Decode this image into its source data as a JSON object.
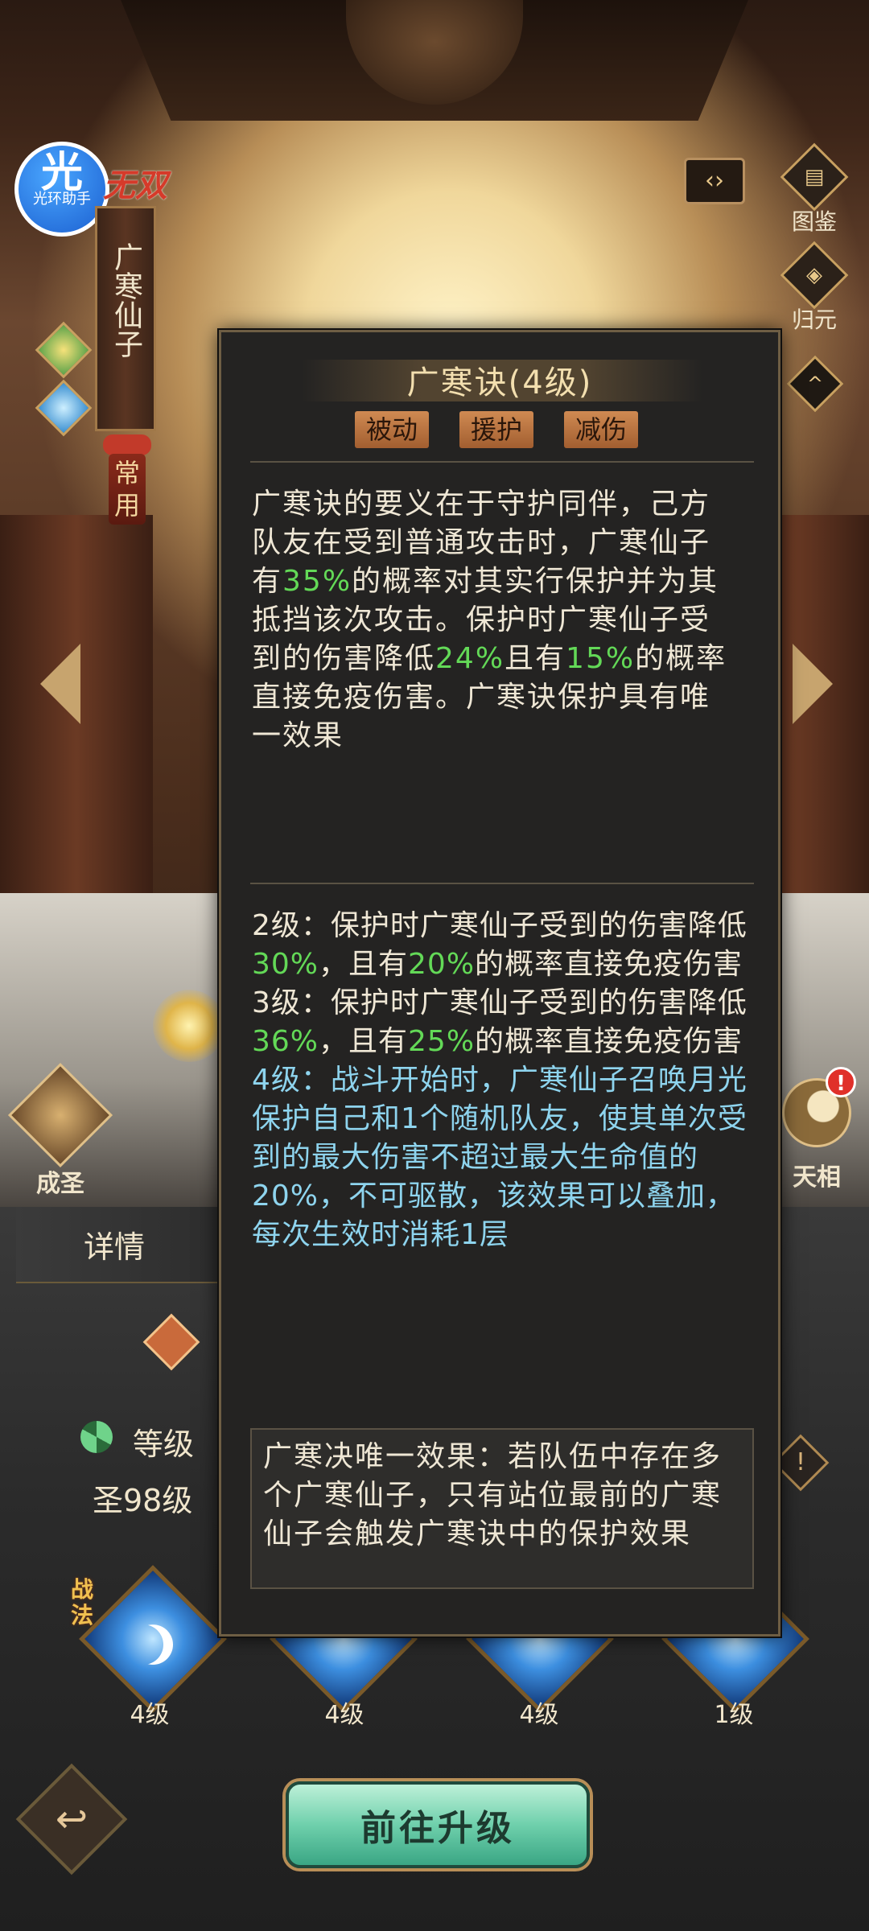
{
  "hero": {
    "badge_text": "光",
    "badge_sub": "光环助手",
    "title_tag": "无双",
    "name": "广寒仙子",
    "common_tag": "常用"
  },
  "side": {
    "tujian": "图鉴",
    "guiyuan": "归元",
    "chengsheng": "成圣",
    "tianxiang": "天相",
    "alert": "!"
  },
  "detail": {
    "tab_label": "详情",
    "level_label": "等级",
    "level_value": "圣98级",
    "warn": "!"
  },
  "skills": {
    "battle_tag": "战法",
    "slots": [
      {
        "level": "4级"
      },
      {
        "level": "4级"
      },
      {
        "level": "4级"
      },
      {
        "level": "1级"
      }
    ]
  },
  "buttons": {
    "back": "↩",
    "go_upgrade": "前往升级"
  },
  "popup": {
    "title": "广寒诀(4级)",
    "tags": [
      "被动",
      "援护",
      "减伤"
    ],
    "desc": {
      "p1": "广寒诀的要义在于守护同伴，己方队友在受到普通攻击时，广寒仙子有",
      "v1": "35%",
      "p2": "的概率对其实行保护并为其抵挡该次攻击。保护时广寒仙子受到的伤害降低",
      "v2": "24%",
      "p3": "且有",
      "v3": "15%",
      "p4": "的概率直接免疫伤害。广寒诀保护具有唯一效果"
    },
    "level2": {
      "a": "2级：保护时广寒仙子受到的伤害降低",
      "v1": "30%",
      "b": "，且有",
      "v2": "20%",
      "c": "的概率直接免疫伤害"
    },
    "level3": {
      "a": "3级：保护时广寒仙子受到的伤害降低",
      "v1": "36%",
      "b": "，且有",
      "v2": "25%",
      "c": "的概率直接免疫伤害"
    },
    "level4": "4级：战斗开始时，广寒仙子召唤月光保护自己和1个随机队友，使其单次受到的最大伤害不超过最大生命值的20%，不可驱散，该效果可以叠加，每次生效时消耗1层",
    "unique": "广寒决唯一效果：若队伍中存在多个广寒仙子，只有站位最前的广寒仙子会触发广寒诀中的保护效果"
  },
  "colors": {
    "highlight_green": "#63d957",
    "current_level_blue": "#8ed4ee",
    "tag_orange": "#d08a52",
    "upgrade_green": "#6fd0ac"
  }
}
